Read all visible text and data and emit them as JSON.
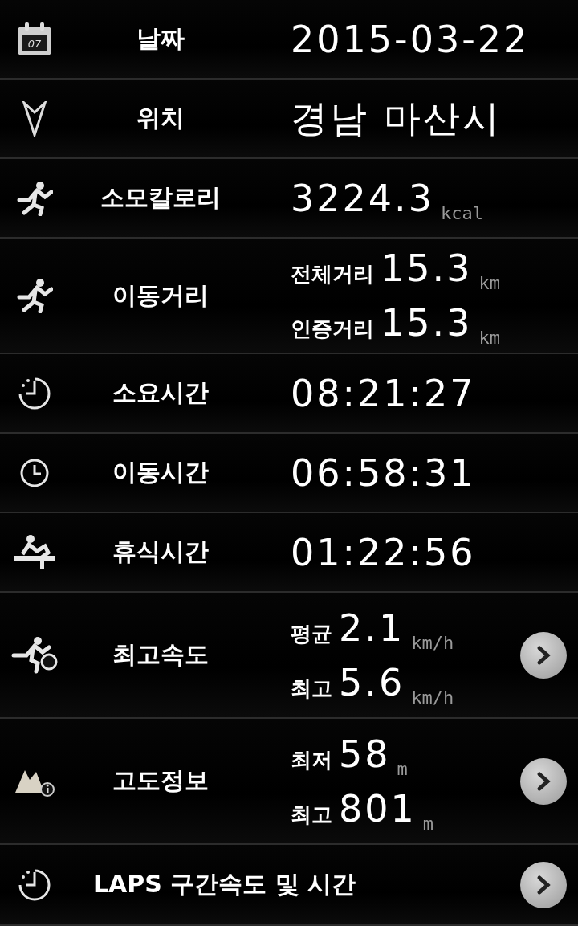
{
  "rows": [
    {
      "kind": "single",
      "title": "날짜",
      "icon_text": "07",
      "value": "2015-03-22"
    },
    {
      "kind": "single",
      "title": "위치",
      "value": "경남 마산시"
    },
    {
      "kind": "single",
      "title": "소모칼로리",
      "value": "3224.3",
      "unit": "kcal"
    },
    {
      "kind": "double",
      "title": "이동거리",
      "lines": [
        {
          "label": "전체거리",
          "value": "15.3",
          "unit": "km"
        },
        {
          "label": "인증거리",
          "value": "15.3",
          "unit": "km"
        }
      ]
    },
    {
      "kind": "single",
      "title": "소요시간",
      "value": "08:21:27"
    },
    {
      "kind": "single",
      "title": "이동시간",
      "value": "06:58:31"
    },
    {
      "kind": "single",
      "title": "휴식시간",
      "value": "01:22:56"
    },
    {
      "kind": "double",
      "title": "최고속도",
      "link": true,
      "lines": [
        {
          "label": "평균",
          "value": "2.1",
          "unit": "km/h"
        },
        {
          "label": "최고",
          "value": "5.6",
          "unit": "km/h"
        }
      ]
    },
    {
      "kind": "double",
      "title": "고도정보",
      "link": true,
      "lines": [
        {
          "label": "최저",
          "value": "58",
          "unit": "m"
        },
        {
          "label": "최고",
          "value": "801",
          "unit": "m"
        }
      ]
    },
    {
      "kind": "wide",
      "title": "LAPS 구간속도 및 시간",
      "link": true
    }
  ]
}
